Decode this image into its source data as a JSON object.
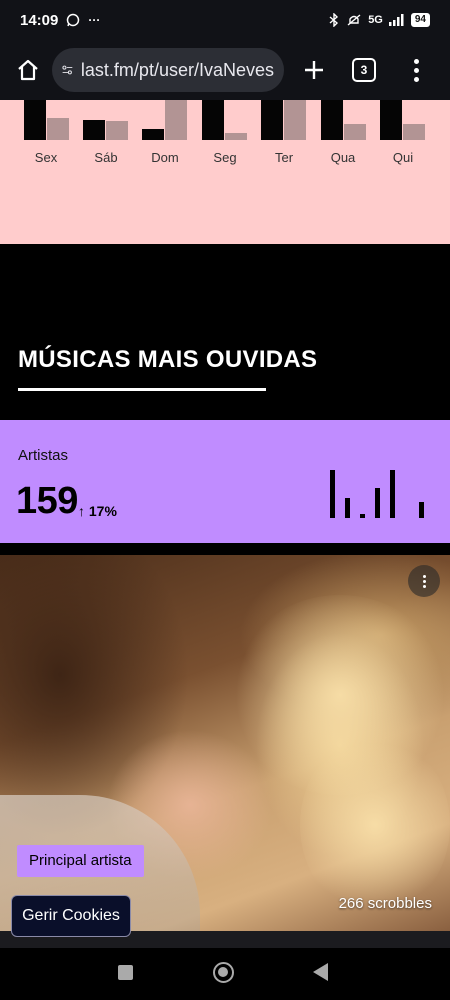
{
  "status_bar": {
    "time": "14:09",
    "signal_label": "5G",
    "battery": "94",
    "more_glyph": "···"
  },
  "browser": {
    "url": "last.fm/pt/user/IvaNeves",
    "tab_count": "3"
  },
  "weekly_chart": {
    "days": [
      "Sex",
      "Sáb",
      "Dom",
      "Seg",
      "Ter",
      "Qua",
      "Qui"
    ]
  },
  "section": {
    "title": "MÚSICAS MAIS OUVIDAS"
  },
  "stats_card": {
    "label": "Artistas",
    "value": "159",
    "change": "↑ 17%",
    "accent_color": "#c08cff"
  },
  "top_artist_card": {
    "badge": "Principal artista",
    "scrobbles": "266 scrobbles"
  },
  "cookies_button": "Gerir Cookies",
  "colors": {
    "pink_panel": "#ffcccc",
    "purple": "#c08cff",
    "browser_bg": "#111217"
  }
}
